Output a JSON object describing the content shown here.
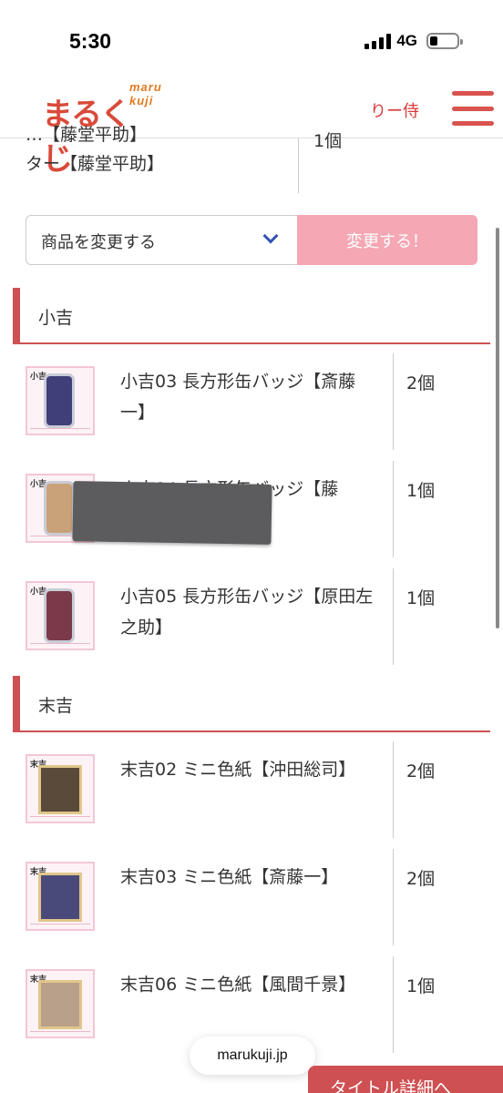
{
  "status": {
    "time": "5:30",
    "network": "4G",
    "battery_level": 0.28
  },
  "header": {
    "logo_sub": "maru kuji",
    "logo_main": "まるくじ",
    "user_name": "りー侍"
  },
  "top_row": {
    "name": "…【藤堂平助】",
    "name_line2": "ター【藤堂平助】",
    "qty": "1個"
  },
  "change": {
    "select_value": "商品を変更する",
    "button_label": "変更する！"
  },
  "sections": [
    {
      "label": "小吉",
      "items": [
        {
          "name": "小吉03 長方形缶バッジ【斎藤一】",
          "qty": "2個",
          "thumb_tag": "小吉",
          "color": "#3f3f7a"
        },
        {
          "name": "小吉04 長方形缶バッジ【藤",
          "qty": "1個",
          "thumb_tag": "小吉",
          "color": "#c9a27a"
        },
        {
          "name": "小吉05 長方形缶バッジ【原田左之助】",
          "qty": "1個",
          "thumb_tag": "小吉",
          "color": "#7a3a4a"
        }
      ]
    },
    {
      "label": "末吉",
      "items": [
        {
          "name": "末吉02 ミニ色紙【沖田総司】",
          "qty": "2個",
          "thumb_tag": "末吉",
          "color": "#5a4a3a"
        },
        {
          "name": "末吉03 ミニ色紙【斎藤一】",
          "qty": "2個",
          "thumb_tag": "末吉",
          "color": "#4a4a7a"
        },
        {
          "name": "末吉06 ミニ色紙【風間千景】",
          "qty": "1個",
          "thumb_tag": "末吉",
          "color": "#b8a08a"
        }
      ]
    }
  ],
  "browser": {
    "url": "marukuji.jp"
  },
  "footer": {
    "title_detail_button": "タイトル詳細へ"
  }
}
